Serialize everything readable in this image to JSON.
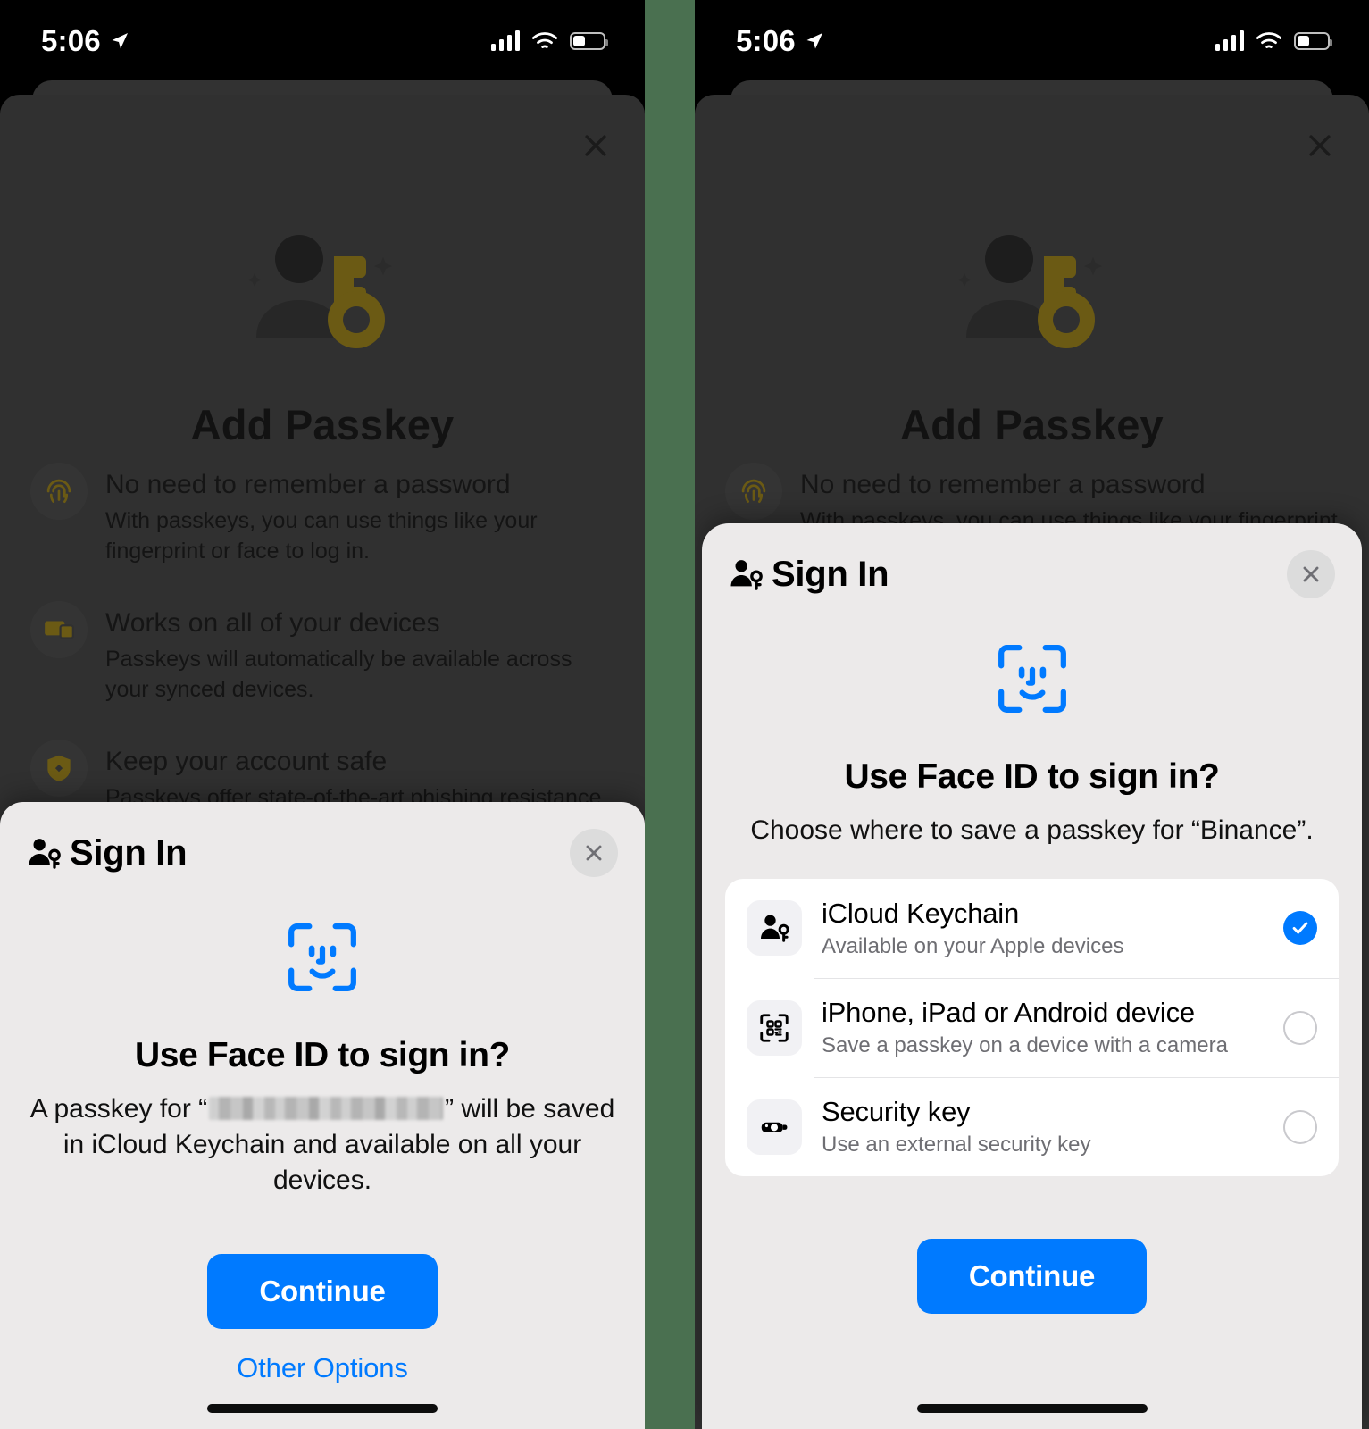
{
  "status_bar": {
    "time": "5:06",
    "location_icon": "location-arrow-icon",
    "signal_icon": "cellular-signal-icon",
    "wifi_icon": "wifi-icon",
    "battery_icon": "battery-icon"
  },
  "colors": {
    "accent_blue": "#007aff",
    "divider_green": "#4a7050",
    "dark_card": "#303030",
    "sheet_bg": "#eceaea",
    "key_gold": "#6b5a14"
  },
  "dark_modal": {
    "close_icon": "close-icon",
    "hero_icon": "passkey-person-key-icon",
    "title": "Add Passkey",
    "features": [
      {
        "icon": "fingerprint-icon",
        "title": "No need to remember a password",
        "desc": "With passkeys, you can use things like your fingerprint or face to log in."
      },
      {
        "icon": "devices-icon",
        "title": "Works on all of your devices",
        "desc": "Passkeys will automatically be available across your synced devices."
      },
      {
        "icon": "shield-icon",
        "title": "Keep your account safe",
        "desc": "Passkeys offer state-of-the-art phishing resistance."
      }
    ]
  },
  "left_sheet": {
    "header_icon": "person-key-icon",
    "header_title": "Sign In",
    "close_icon": "close-icon",
    "faceid_icon": "face-id-icon",
    "question": "Use Face ID to sign in?",
    "body_before": "A passkey for “",
    "redacted_value": "████████████",
    "body_after": "” will be saved in iCloud Keychain and available on all your devices.",
    "continue_label": "Continue",
    "other_options_label": "Other Options"
  },
  "right_sheet": {
    "header_icon": "person-key-icon",
    "header_title": "Sign In",
    "close_icon": "close-icon",
    "faceid_icon": "face-id-icon",
    "question": "Use Face ID to sign in?",
    "subtitle": "Choose where to save a passkey for “Binance”.",
    "relying_party": "Binance",
    "options": [
      {
        "icon": "person-key-icon",
        "title": "iCloud Keychain",
        "desc": "Available on your Apple devices",
        "selected": true,
        "control": "checkmark-icon"
      },
      {
        "icon": "qr-scan-icon",
        "title": "iPhone, iPad or Android device",
        "desc": "Save a passkey on a device with a camera",
        "selected": false,
        "control": "radio-empty-icon"
      },
      {
        "icon": "security-key-icon",
        "title": "Security key",
        "desc": "Use an external security key",
        "selected": false,
        "control": "radio-empty-icon"
      }
    ],
    "continue_label": "Continue"
  }
}
